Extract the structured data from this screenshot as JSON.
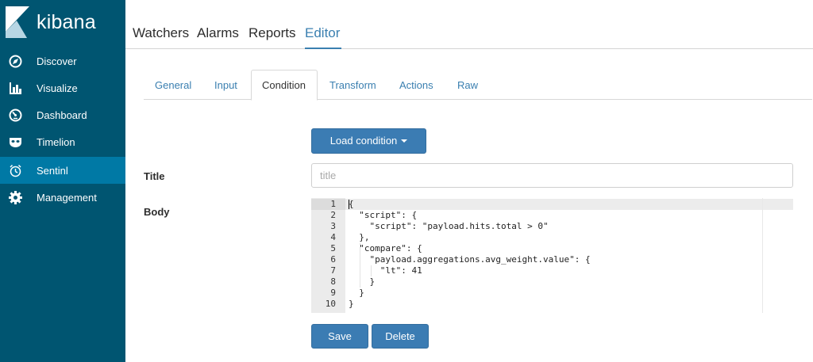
{
  "app": {
    "logo_text": "kibana"
  },
  "sidebar": {
    "items": [
      {
        "label": "Discover",
        "icon": "compass-icon"
      },
      {
        "label": "Visualize",
        "icon": "bar-chart-icon"
      },
      {
        "label": "Dashboard",
        "icon": "dashboard-gauge-icon"
      },
      {
        "label": "Timelion",
        "icon": "timelion-mask-icon"
      },
      {
        "label": "Sentinl",
        "icon": "alarm-clock-icon",
        "active": true
      },
      {
        "label": "Management",
        "icon": "gear-icon"
      }
    ]
  },
  "top_tabs": [
    {
      "label": "Watchers"
    },
    {
      "label": "Alarms"
    },
    {
      "label": "Reports"
    },
    {
      "label": "Editor",
      "active": true
    }
  ],
  "sub_tabs": [
    {
      "label": "General"
    },
    {
      "label": "Input"
    },
    {
      "label": "Condition",
      "active": true
    },
    {
      "label": "Transform"
    },
    {
      "label": "Actions"
    },
    {
      "label": "Raw"
    }
  ],
  "load_condition": {
    "label": "Load condition"
  },
  "form": {
    "title_label": "Title",
    "title_placeholder": "title",
    "title_value": "",
    "body_label": "Body"
  },
  "editor": {
    "lines": [
      {
        "no": "1",
        "code": "{"
      },
      {
        "no": "2",
        "code": "  \"script\": {"
      },
      {
        "no": "3",
        "code": "    \"script\": \"payload.hits.total > 0\""
      },
      {
        "no": "4",
        "code": "  },"
      },
      {
        "no": "5",
        "code": "  \"compare\": {"
      },
      {
        "no": "6",
        "code": "    \"payload.aggregations.avg_weight.value\": {"
      },
      {
        "no": "7",
        "code": "      \"lt\": 41"
      },
      {
        "no": "8",
        "code": "    }"
      },
      {
        "no": "9",
        "code": "  }"
      },
      {
        "no": "10",
        "code": "}"
      }
    ]
  },
  "actions": {
    "save_label": "Save",
    "delete_label": "Delete"
  },
  "colors": {
    "sidebar_bg": "#005571",
    "sidebar_active": "#0079a5",
    "accent": "#3a7fb0",
    "button_bg": "#3b7cb3"
  }
}
